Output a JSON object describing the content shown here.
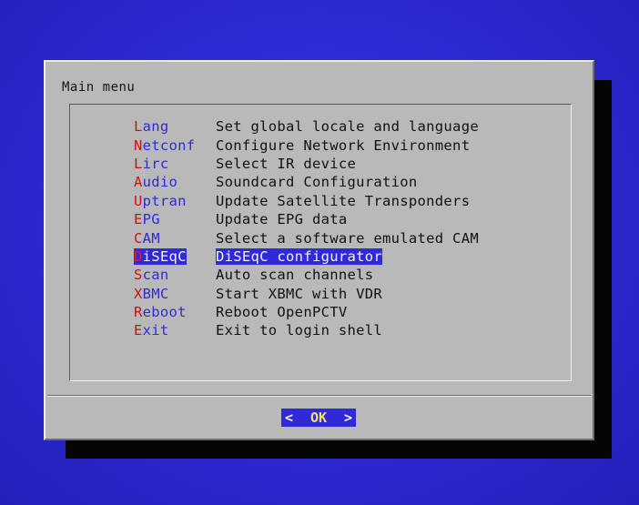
{
  "dialog": {
    "title": "Main menu",
    "ok_button": {
      "left": "<",
      "label": "OK",
      "right": ">"
    }
  },
  "menu": [
    {
      "hot": "L",
      "rest": "ang",
      "description": "Set global locale and language",
      "selected": false
    },
    {
      "hot": "N",
      "rest": "etconf",
      "description": "Configure Network Environment",
      "selected": false
    },
    {
      "hot": "L",
      "rest": "irc",
      "description": "Select IR device",
      "selected": false
    },
    {
      "hot": "A",
      "rest": "udio",
      "description": "Soundcard Configuration",
      "selected": false
    },
    {
      "hot": "U",
      "rest": "ptran",
      "description": "Update Satellite Transponders",
      "selected": false
    },
    {
      "hot": "E",
      "rest": "PG",
      "description": "Update EPG data",
      "selected": false
    },
    {
      "hot": "C",
      "rest": "AM",
      "description": "Select a software emulated CAM",
      "selected": false
    },
    {
      "hot": "D",
      "rest": "iSEqC",
      "description": "DiSEqC configurator",
      "selected": true
    },
    {
      "hot": "S",
      "rest": "can",
      "description": "Auto scan channels",
      "selected": false
    },
    {
      "hot": "X",
      "rest": "BMC",
      "description": "Start XBMC with VDR",
      "selected": false
    },
    {
      "hot": "R",
      "rest": "eboot",
      "description": "Reboot OpenPCTV",
      "selected": false
    },
    {
      "hot": "E",
      "rest": "xit",
      "description": "Exit to login shell",
      "selected": false
    }
  ],
  "colors": {
    "background": "#2f2ad6",
    "dialog": "#b9b9b9",
    "hotkey": "#c41414",
    "highlight": "#2f2ad6"
  }
}
